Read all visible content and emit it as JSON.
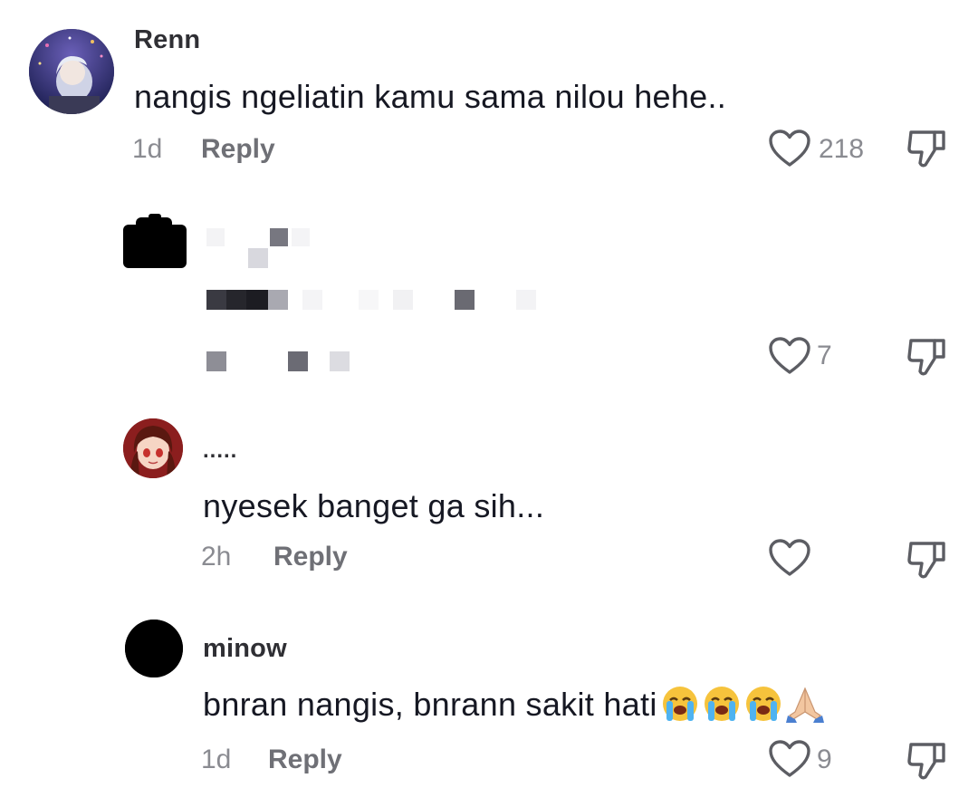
{
  "comments": [
    {
      "username": "Renn",
      "text": "nangis ngeliatin kamu sama nilou hehe..",
      "time": "1d",
      "reply": "Reply",
      "likes": "218",
      "avatar_icon": "anime-avatar-icon"
    },
    {
      "username": "",
      "text": "",
      "time": "",
      "reply": "",
      "likes": "7",
      "avatar_icon": "censored-avatar-icon"
    },
    {
      "username": ".....",
      "text": "nyesek banget ga sih...",
      "time": "2h",
      "reply": "Reply",
      "likes": "",
      "avatar_icon": "anime-girl-avatar-icon"
    },
    {
      "username": "minow",
      "text": "bnran nangis, bnrann sakit hati",
      "emojis": [
        "loudly-crying-face",
        "loudly-crying-face",
        "loudly-crying-face",
        "folded-hands"
      ],
      "time": "1d",
      "reply": "Reply",
      "likes": "9",
      "avatar_icon": "black-circle-avatar"
    }
  ],
  "colors": {
    "text": "#161823",
    "secondary": "#8a8b91",
    "icon": "#5c5d63"
  }
}
